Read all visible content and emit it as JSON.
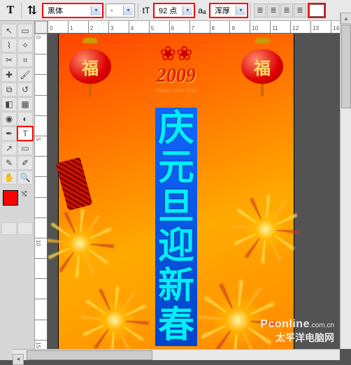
{
  "options_bar": {
    "tool_glyph": "T",
    "orientation_glyph": "⇅",
    "font_family": "黑体",
    "font_style": "-",
    "size_prefix_glyph": "tT",
    "font_size": "92 点",
    "aa_prefix": "aₐ",
    "anti_alias": "浑厚",
    "align_glyphs": [
      "≣",
      "≣",
      "≣",
      "≣"
    ],
    "color_value": "#ffffff"
  },
  "tools": {
    "items": [
      {
        "name": "move-tool",
        "glyph": "↖"
      },
      {
        "name": "marquee-tool",
        "glyph": "▭"
      },
      {
        "name": "lasso-tool",
        "glyph": "⌇"
      },
      {
        "name": "magic-wand-tool",
        "glyph": "✧"
      },
      {
        "name": "crop-tool",
        "glyph": "✂"
      },
      {
        "name": "slice-tool",
        "glyph": "⌗"
      },
      {
        "name": "healing-brush-tool",
        "glyph": "✚"
      },
      {
        "name": "brush-tool",
        "glyph": "🖌"
      },
      {
        "name": "stamp-tool",
        "glyph": "⧉"
      },
      {
        "name": "history-brush-tool",
        "glyph": "↺"
      },
      {
        "name": "eraser-tool",
        "glyph": "◧"
      },
      {
        "name": "gradient-tool",
        "glyph": "▦"
      },
      {
        "name": "blur-tool",
        "glyph": "◉"
      },
      {
        "name": "dodge-tool",
        "glyph": "◐"
      },
      {
        "name": "pen-tool",
        "glyph": "✒"
      },
      {
        "name": "type-tool",
        "glyph": "T",
        "selected": true,
        "hl": true
      },
      {
        "name": "path-select-tool",
        "glyph": "↗"
      },
      {
        "name": "shape-tool",
        "glyph": "▭"
      },
      {
        "name": "notes-tool",
        "glyph": "✎"
      },
      {
        "name": "eyedropper-tool",
        "glyph": "✐"
      },
      {
        "name": "hand-tool",
        "glyph": "✋"
      },
      {
        "name": "zoom-tool",
        "glyph": "🔍"
      }
    ],
    "fg_color": "#ff0000",
    "bg_color": "#ffffff"
  },
  "ruler": {
    "h": [
      "0",
      "1",
      "2",
      "3",
      "4",
      "5",
      "6",
      "7",
      "8",
      "9",
      "10",
      "11",
      "12",
      "13",
      "14"
    ],
    "v": [
      "0",
      "",
      "",
      "",
      "",
      "5",
      "",
      "",
      "",
      "",
      "10",
      "",
      "",
      "",
      "",
      "15"
    ]
  },
  "artwork": {
    "lantern_char": "福",
    "year": "2009",
    "subtitle": "Happy New Year",
    "vertical_chars": [
      "庆",
      "元",
      "旦",
      "迎",
      "新",
      "春"
    ]
  },
  "watermark": {
    "main": "Pconline",
    "domain": ".com.cn",
    "sub": "太平洋电脑网"
  }
}
